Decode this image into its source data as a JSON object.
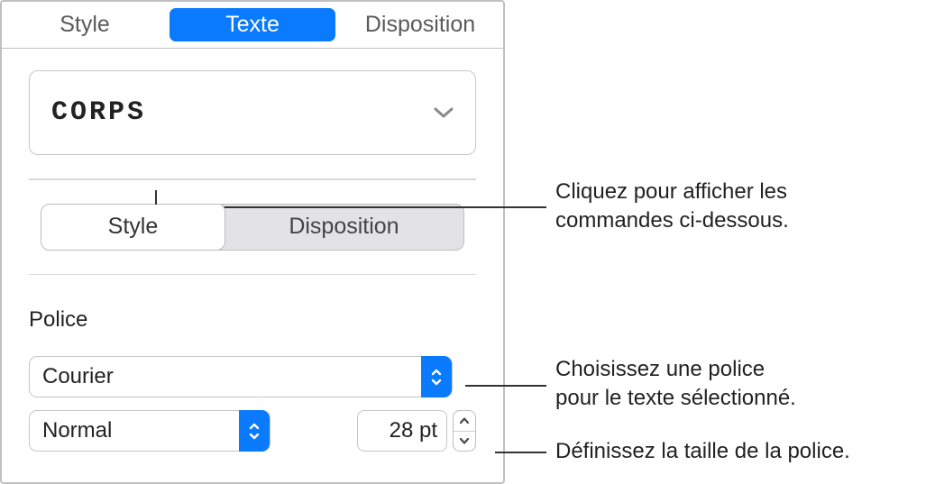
{
  "topTabs": {
    "style": "Style",
    "texte": "Texte",
    "disposition": "Disposition"
  },
  "paragraphStyle": {
    "label": "CORPS"
  },
  "segmented": {
    "style": "Style",
    "disposition": "Disposition"
  },
  "police": {
    "sectionLabel": "Police",
    "fontFamily": "Courier",
    "typeface": "Normal",
    "size": "28 pt"
  },
  "annotations": {
    "a1l1": "Cliquez pour afficher les",
    "a1l2": "commandes ci-dessous.",
    "a2l1": "Choisissez une police",
    "a2l2": "pour le texte sélectionné.",
    "a3": "Définissez la taille de la police."
  }
}
